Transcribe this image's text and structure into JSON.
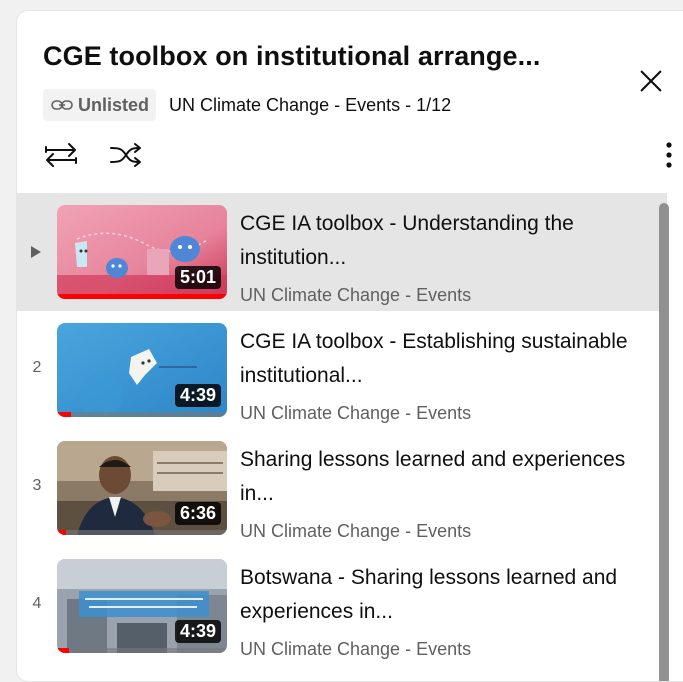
{
  "header": {
    "title": "CGE toolbox on institutional arrange...",
    "badge_label": "Unlisted",
    "meta": "UN Climate Change - Events - 1/12"
  },
  "icons": {
    "close": "close-icon",
    "link": "link-icon",
    "repeat": "repeat-icon",
    "shuffle": "shuffle-icon",
    "more": "more-vertical-icon",
    "play": "play-indicator-icon"
  },
  "colors": {
    "accent_progress": "#ff0000",
    "active_row": "#e5e5e5",
    "secondary_text": "#606060"
  },
  "items": [
    {
      "index": "",
      "active": true,
      "title": "CGE IA toolbox - Understanding the institution...",
      "channel": "UN Climate Change - Events",
      "duration": "5:01",
      "progress": 1.0
    },
    {
      "index": "2",
      "active": false,
      "title": "CGE IA toolbox - Establishing sustainable institutional...",
      "channel": "UN Climate Change - Events",
      "duration": "4:39",
      "progress": 0.08
    },
    {
      "index": "3",
      "active": false,
      "title": "Sharing lessons learned and experiences in...",
      "channel": "UN Climate Change - Events",
      "duration": "6:36",
      "progress": 0.05
    },
    {
      "index": "4",
      "active": false,
      "title": "Botswana - Sharing lessons learned and experiences in...",
      "channel": "UN Climate Change - Events",
      "duration": "4:39",
      "progress": 0.07
    }
  ]
}
